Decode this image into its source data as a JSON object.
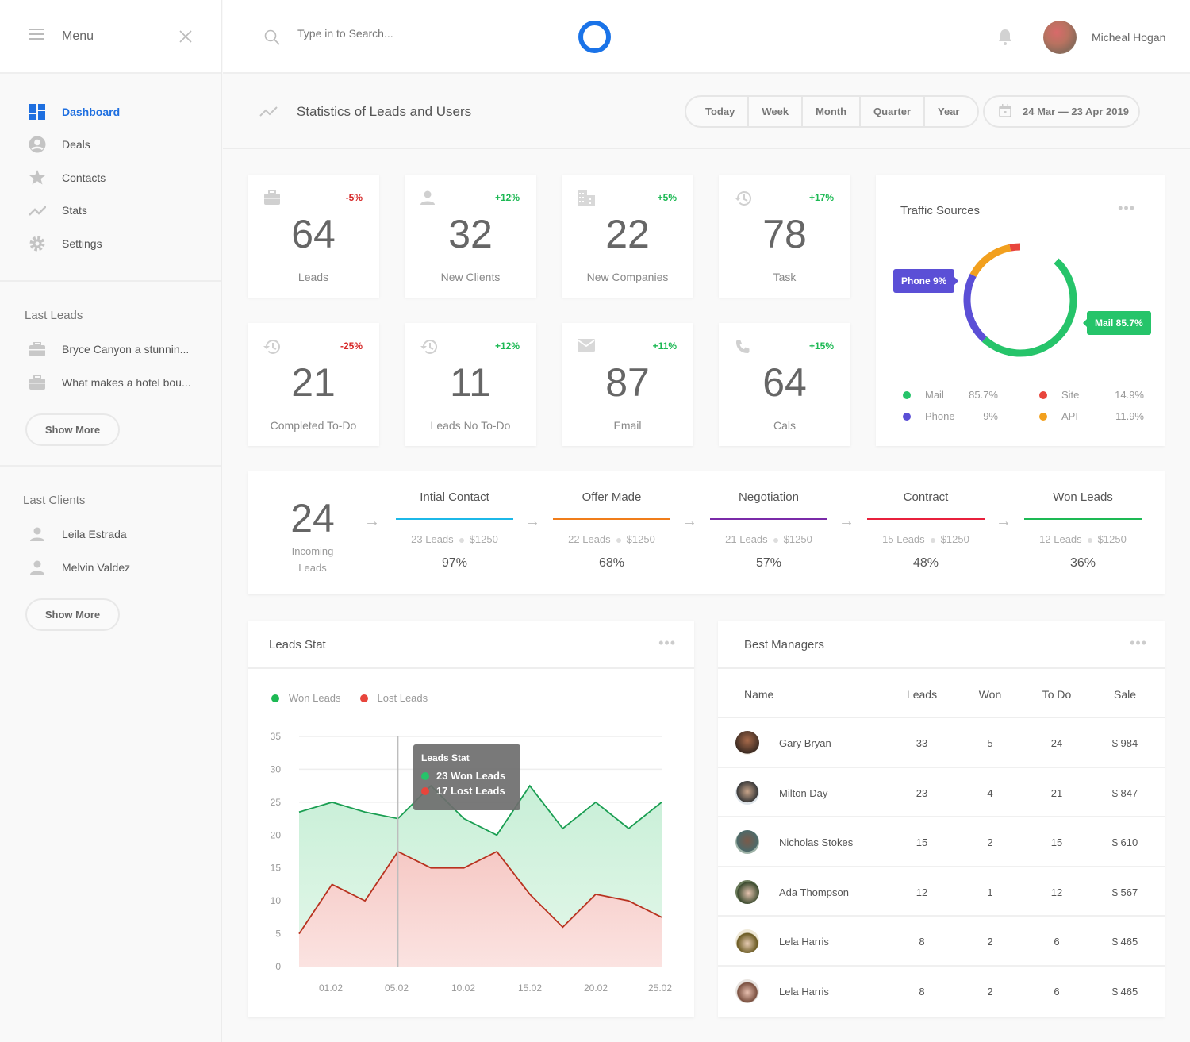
{
  "sidebar": {
    "menu_label": "Menu",
    "nav": [
      {
        "label": "Dashboard",
        "icon": "dashboard-icon",
        "active": true
      },
      {
        "label": "Deals",
        "icon": "account-circle-icon"
      },
      {
        "label": "Contacts",
        "icon": "star-icon"
      },
      {
        "label": "Stats",
        "icon": "trend-icon"
      },
      {
        "label": "Settings",
        "icon": "gear-icon"
      }
    ],
    "last_leads": {
      "title": "Last Leads",
      "items": [
        "Bryce Canyon a stunnin...",
        "What makes a hotel bou..."
      ],
      "show_more": "Show More"
    },
    "last_clients": {
      "title": "Last Clients",
      "items": [
        "Leila Estrada",
        "Melvin Valdez"
      ],
      "show_more": "Show More"
    }
  },
  "topbar": {
    "search_placeholder": "Type in to Search...",
    "username": "Micheal Hogan",
    "brand_color": "#1a73e8"
  },
  "subbar": {
    "title": "Statistics of Leads and Users",
    "periods": [
      "Today",
      "Week",
      "Month",
      "Quarter",
      "Year"
    ],
    "date_range": "24 Mar — 23 Apr 2019"
  },
  "stats": [
    {
      "value": "64",
      "label": "Leads",
      "change": "-5%",
      "trend": "neg",
      "icon": "briefcase-icon"
    },
    {
      "value": "32",
      "label": "New Clients",
      "change": "+12%",
      "trend": "pos",
      "icon": "person-icon"
    },
    {
      "value": "22",
      "label": "New Companies",
      "change": "+5%",
      "trend": "pos",
      "icon": "building-icon"
    },
    {
      "value": "78",
      "label": "Task",
      "change": "+17%",
      "trend": "pos",
      "icon": "history-icon"
    },
    {
      "value": "21",
      "label": "Completed To-Do",
      "change": "-25%",
      "trend": "neg",
      "icon": "history-icon"
    },
    {
      "value": "11",
      "label": "Leads No To-Do",
      "change": "+12%",
      "trend": "pos",
      "icon": "history-icon"
    },
    {
      "value": "87",
      "label": "Email",
      "change": "+11%",
      "trend": "pos",
      "icon": "mail-icon"
    },
    {
      "value": "64",
      "label": "Cals",
      "change": "+15%",
      "trend": "pos",
      "icon": "phone-icon"
    }
  ],
  "traffic": {
    "title": "Traffic Sources",
    "callout_phone": "Phone 9%",
    "callout_mail": "Mail 85.7%",
    "legend": [
      {
        "name": "Mail",
        "value": "85.7%",
        "color": "#26c46a"
      },
      {
        "name": "Phone",
        "value": "9%",
        "color": "#5b4fd6"
      },
      {
        "name": "Site",
        "value": "14.9%",
        "color": "#e8453c"
      },
      {
        "name": "API",
        "value": "11.9%",
        "color": "#f2a01e"
      }
    ]
  },
  "pipeline": {
    "incoming_value": "24",
    "incoming_label_1": "Incoming",
    "incoming_label_2": "Leads",
    "stages": [
      {
        "name": "Intial Contact",
        "leads": "23 Leads",
        "amount": "$1250",
        "pct": "97%",
        "color": "#1cb8e8"
      },
      {
        "name": "Offer Made",
        "leads": "22 Leads",
        "amount": "$1250",
        "pct": "68%",
        "color": "#f07d1a"
      },
      {
        "name": "Negotiation",
        "leads": "21 Leads",
        "amount": "$1250",
        "pct": "57%",
        "color": "#7a2aa8"
      },
      {
        "name": "Contract",
        "leads": "15 Leads",
        "amount": "$1250",
        "pct": "48%",
        "color": "#e8203c"
      },
      {
        "name": "Won Leads",
        "leads": "12 Leads",
        "amount": "$1250",
        "pct": "36%",
        "color": "#1db954"
      }
    ]
  },
  "leads_stat": {
    "title": "Leads Stat",
    "tooltip": {
      "title": "Leads Stat",
      "won": "23 Won Leads",
      "lost": "17 Lost Leads"
    }
  },
  "chart_data": {
    "type": "area",
    "title": "Leads Stat",
    "x_ticks": [
      "01.02",
      "05.02",
      "10.02",
      "15.02",
      "20.02",
      "25.02"
    ],
    "ylim": [
      0,
      35
    ],
    "y_ticks": [
      0,
      5,
      10,
      15,
      20,
      25,
      30,
      35
    ],
    "grid": true,
    "legend_position": "top-left",
    "series": [
      {
        "name": "Won Leads",
        "color": "#1db954",
        "values": [
          23.5,
          25,
          23.5,
          22.5,
          27.5,
          22.5,
          20,
          27.5,
          21,
          25,
          21,
          25
        ]
      },
      {
        "name": "Lost Leads",
        "color": "#e8453c",
        "values": [
          5,
          12.5,
          10,
          17.5,
          15,
          15,
          17.5,
          11,
          6,
          11,
          10,
          7.5
        ]
      }
    ],
    "hover_index": 3
  },
  "managers": {
    "title": "Best Managers",
    "columns": [
      "Name",
      "Leads",
      "Won",
      "To Do",
      "Sale"
    ],
    "rows": [
      {
        "name": "Gary Bryan",
        "leads": "33",
        "won": "5",
        "todo": "24",
        "sale": "$ 984"
      },
      {
        "name": "Milton Day",
        "leads": "23",
        "won": "4",
        "todo": "21",
        "sale": "$ 847"
      },
      {
        "name": "Nicholas Stokes",
        "leads": "15",
        "won": "2",
        "todo": "15",
        "sale": "$ 610"
      },
      {
        "name": "Ada Thompson",
        "leads": "12",
        "won": "1",
        "todo": "12",
        "sale": "$ 567"
      },
      {
        "name": "Lela Harris",
        "leads": "8",
        "won": "2",
        "todo": "6",
        "sale": "$ 465"
      },
      {
        "name": "Lela Harris",
        "leads": "8",
        "won": "2",
        "todo": "6",
        "sale": "$ 465"
      }
    ]
  }
}
